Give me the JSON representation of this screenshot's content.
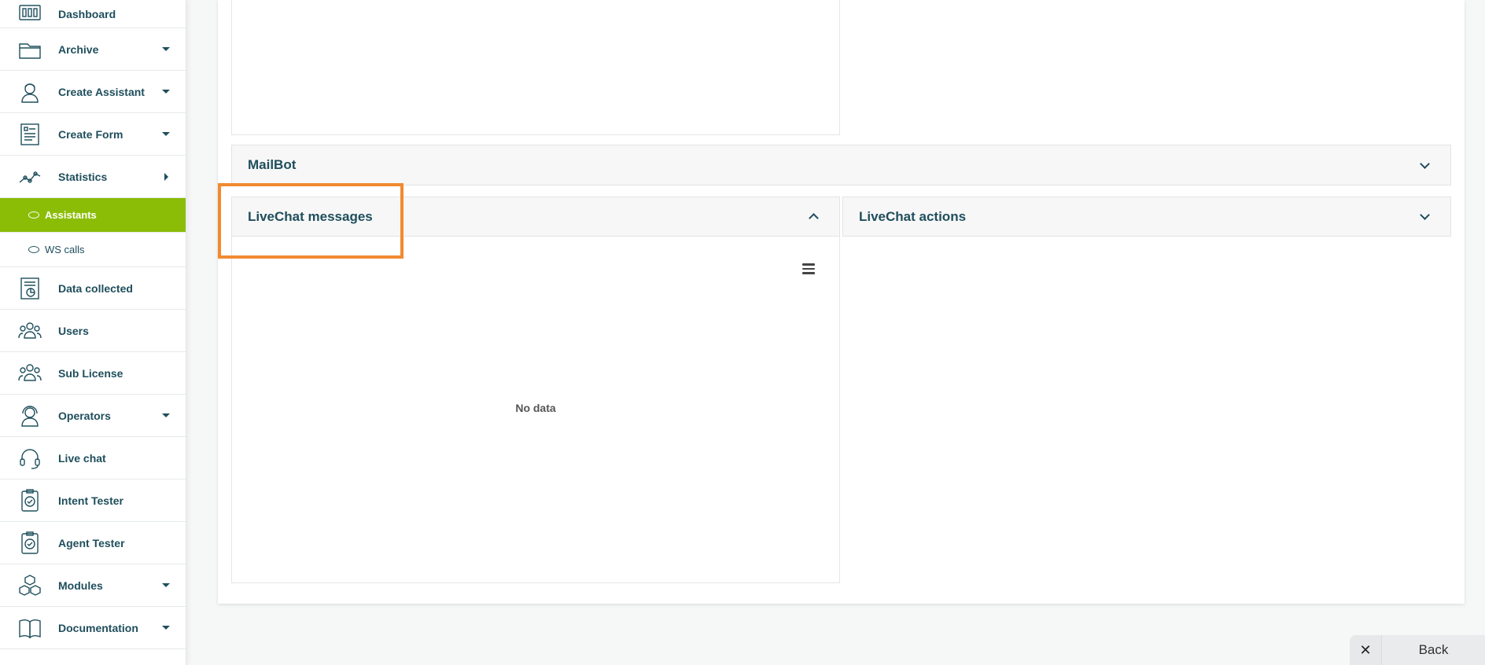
{
  "sidebar": {
    "items": [
      {
        "label": "Dashboard",
        "icon": "dashboard-icon"
      },
      {
        "label": "Archive",
        "icon": "folder-icon"
      },
      {
        "label": "Create Assistant",
        "icon": "assistant-icon"
      },
      {
        "label": "Create Form",
        "icon": "form-icon"
      },
      {
        "label": "Statistics",
        "icon": "statistics-icon"
      },
      {
        "label": "Data collected",
        "icon": "data-collected-icon"
      },
      {
        "label": "Users",
        "icon": "users-icon"
      },
      {
        "label": "Sub License",
        "icon": "sub-license-icon"
      },
      {
        "label": "Operators",
        "icon": "operator-icon"
      },
      {
        "label": "Live chat",
        "icon": "headset-icon"
      },
      {
        "label": "Intent Tester",
        "icon": "intent-tester-icon"
      },
      {
        "label": "Agent Tester",
        "icon": "agent-tester-icon"
      },
      {
        "label": "Modules",
        "icon": "modules-icon"
      },
      {
        "label": "Documentation",
        "icon": "book-icon"
      }
    ],
    "statistics_sub": [
      {
        "label": "Assistants",
        "active": true
      },
      {
        "label": "WS calls",
        "active": false
      }
    ]
  },
  "main": {
    "mailbot_title": "MailBot",
    "livechat_messages_title": "LiveChat messages",
    "livechat_actions_title": "LiveChat actions",
    "no_data_text": "No data"
  },
  "footer": {
    "close_symbol": "✕",
    "back_label": "Back"
  },
  "colors": {
    "accent_green": "#8bbd07",
    "highlight_orange": "#f28a30",
    "text_teal": "#1f4e5c"
  }
}
